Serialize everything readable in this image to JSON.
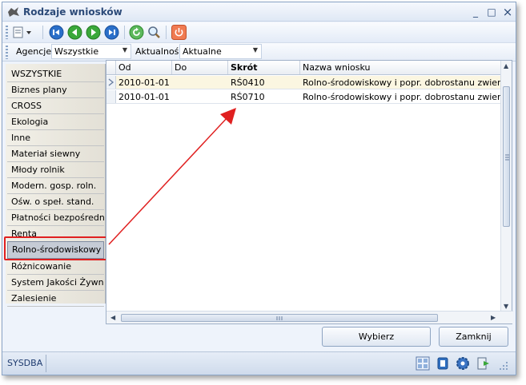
{
  "window": {
    "title": "Rodzaje wniosków",
    "minimize": "_",
    "maximize": "□",
    "close": "×"
  },
  "filters": {
    "agency_label": "Agencje",
    "agency_value": "Wszystkie",
    "status_label": "Aktualność",
    "status_value": "Aktualne"
  },
  "categories": [
    "WSZYSTKIE",
    "Biznes plany",
    "CROSS",
    "Ekologia",
    "Inne",
    "Materiał siewny",
    "Młody rolnik",
    "Modern. gosp. roln.",
    "Ośw. o speł. stand.",
    "Płatności bezpośrednie",
    "Renta",
    "Rolno-środowiskowy",
    "Różnicowanie",
    "System Jakości Żywn.",
    "Zalesienie"
  ],
  "selected_category": "Rolno-środowiskowy",
  "table": {
    "columns": [
      "Od",
      "Do",
      "Skrót",
      "Nazwa wniosku"
    ],
    "rows": [
      {
        "od": "2010-01-01",
        "do": "",
        "skrot": "RŚ0410",
        "nazwa": "Rolno-środowiskowy i popr. dobrostanu zwierząt"
      },
      {
        "od": "2010-01-01",
        "do": "",
        "skrot": "RŚ0710",
        "nazwa": "Rolno-środowiskowy i popr. dobrostanu zwierząt"
      }
    ]
  },
  "buttons": {
    "select": "Wybierz",
    "close": "Zamknij"
  },
  "status": {
    "user": "SYSDBA"
  },
  "colors": {
    "highlight": "#e02020",
    "accent": "#2b4a78"
  }
}
